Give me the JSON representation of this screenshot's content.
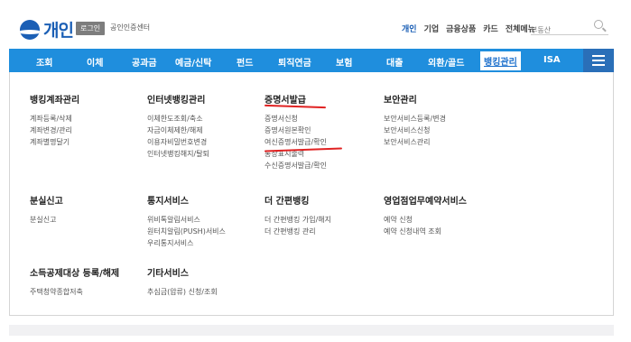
{
  "header": {
    "logo_text": "개인",
    "login_label": "로그인",
    "cert_label": "공인인증센터",
    "top_nav": [
      "개인",
      "기업",
      "금융상품",
      "카드",
      "전체메뉴"
    ],
    "search": {
      "placeholder": "부동산"
    }
  },
  "main_nav": {
    "items": [
      "조회",
      "이체",
      "공과금",
      "예금/신탁",
      "펀드",
      "퇴직연금",
      "보험",
      "대출",
      "외환/골드",
      "뱅킹관리",
      "ISA"
    ],
    "active": "뱅킹관리"
  },
  "menu": {
    "account_mgmt": {
      "title": "뱅킹계좌관리",
      "links": [
        "계좌등록/삭제",
        "계좌변경/관리",
        "계좌별명달기"
      ]
    },
    "internet_banking": {
      "title": "인터넷뱅킹관리",
      "links": [
        "이체한도조회/축소",
        "자금이체제한/해제",
        "이용자비밀번호변경",
        "인터넷뱅킹해지/탈퇴"
      ]
    },
    "certificates": {
      "title": "증명서발급",
      "links": [
        "증명서신청",
        "증명서원본확인",
        "여신증명서발급/확인",
        "통장표지출력",
        "수신증명서발급/확인"
      ]
    },
    "security": {
      "title": "보안관리",
      "links": [
        "보안서비스등록/변경",
        "보안서비스신청",
        "보안서비스관리"
      ]
    },
    "lost_report": {
      "title": "분실신고",
      "links": [
        "분실신고"
      ]
    },
    "notification": {
      "title": "통지서비스",
      "links": [
        "위비톡알림서비스",
        "원터치알림(PUSH)서비스",
        "우리통지서비스"
      ]
    },
    "easy_banking": {
      "title": "더 간편뱅킹",
      "links": [
        "더 간편뱅킹 가입/해지",
        "더 간편뱅킹 관리"
      ]
    },
    "reservation": {
      "title": "영업점업무예약서비스",
      "links": [
        "예약 신청",
        "예약 신청내역 조회"
      ]
    },
    "tax_deduction": {
      "title": "소득공제대상 등록/해제",
      "links": [
        "주택청약종합저축"
      ]
    },
    "other_services": {
      "title": "기타서비스",
      "links": [
        "추심금(압류) 신청/조회"
      ]
    }
  },
  "colors": {
    "brand_blue": "#1b5fb5",
    "nav_blue": "#1f8edd",
    "menu_btn_blue": "#2a6fb8",
    "highlight_red": "#e02222"
  },
  "icons": {
    "search": "search-icon",
    "menu": "hamburger-icon",
    "logo": "logo-icon"
  }
}
